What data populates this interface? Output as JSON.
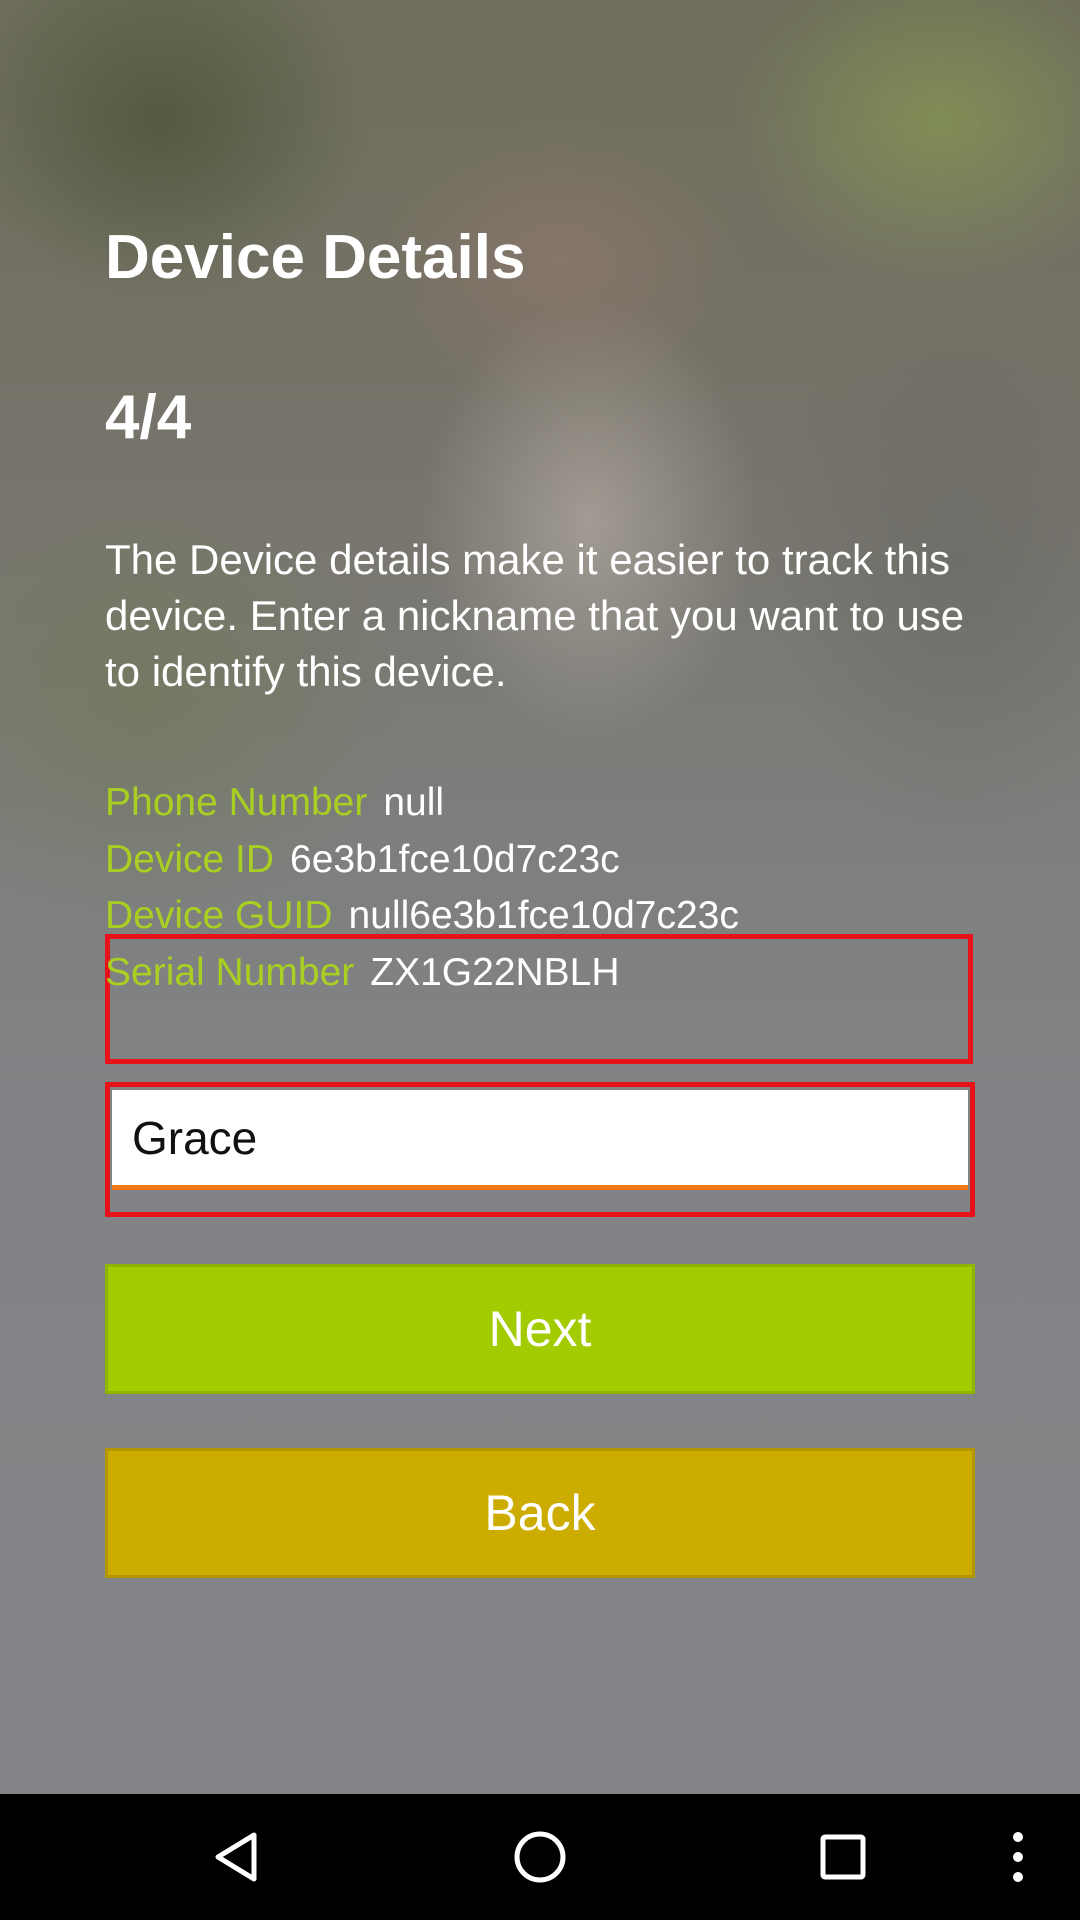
{
  "page": {
    "title": "Device Details",
    "step": "4/4",
    "description": "The Device details make it easier to track this device. Enter a nickname that you want to use to identify this device."
  },
  "details": [
    {
      "label": "Phone Number",
      "value": "null"
    },
    {
      "label": "Device ID",
      "value": "6e3b1fce10d7c23c"
    },
    {
      "label": "Device GUID",
      "value": "null6e3b1fce10d7c23c"
    },
    {
      "label": "Serial Number",
      "value": "ZX1G22NBLH"
    }
  ],
  "nickname": {
    "value": "Grace"
  },
  "buttons": {
    "next_label": "Next",
    "back_label": "Back"
  },
  "colors": {
    "label_green": "#a8cf22",
    "next_button": "#a3cc00",
    "back_button": "#cdac00",
    "highlight_red": "#e8121b",
    "input_underline": "#f07a17"
  },
  "navbar": {
    "icons": [
      "back-triangle-icon",
      "home-circle-icon",
      "recent-apps-square-icon",
      "overflow-menu-icon"
    ]
  }
}
